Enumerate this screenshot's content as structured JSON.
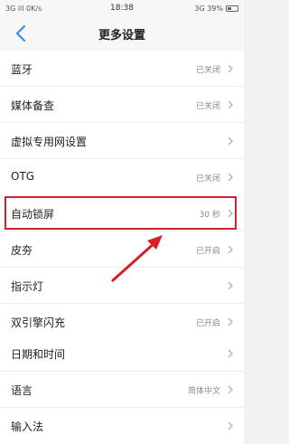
{
  "status_bar": {
    "left_text": "3G  ill  0K/s",
    "time": "18:38",
    "right_text": "3G  39%",
    "battery_level": 0.39
  },
  "header": {
    "title": "更多设置",
    "back_icon": "chevron-left-icon"
  },
  "groups": [
    {
      "items": [
        {
          "label": "蓝牙",
          "value": "已关闭"
        },
        {
          "label": "媒体备查",
          "value": "已关闭"
        },
        {
          "label": "虚拟专用网设置",
          "value": ""
        },
        {
          "label": "OTG",
          "value": "已关闭"
        }
      ]
    },
    {
      "items": [
        {
          "label": "自动锁屏",
          "value": "30 秒"
        },
        {
          "label": "皮夯",
          "value": "已开启"
        },
        {
          "label": "指示灯",
          "value": ""
        },
        {
          "label": "双引擎闪充",
          "value": "已开启"
        }
      ]
    },
    {
      "items": [
        {
          "label": "日期和时间",
          "value": ""
        },
        {
          "label": "语言",
          "value": "简体中文"
        },
        {
          "label": "输入法",
          "value": ""
        }
      ]
    }
  ],
  "colors": {
    "accent": "#2a8ce6",
    "highlight": "#d81e2c",
    "background": "#f2f2f4"
  }
}
